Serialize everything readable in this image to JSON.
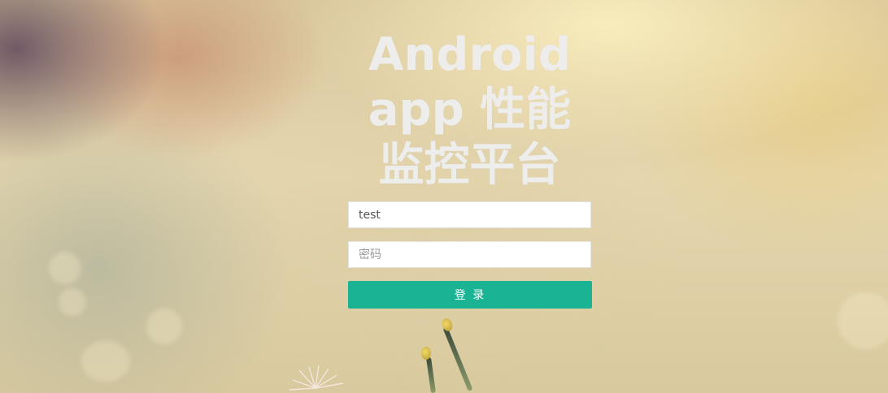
{
  "title": {
    "line1": "Android",
    "line2": "app 性能",
    "line3": "监控平台"
  },
  "form": {
    "username_value": "test",
    "password_placeholder": "密码",
    "login_label": "登 录"
  },
  "colors": {
    "accent": "#1ab394",
    "title_text": "#eeeeee"
  }
}
